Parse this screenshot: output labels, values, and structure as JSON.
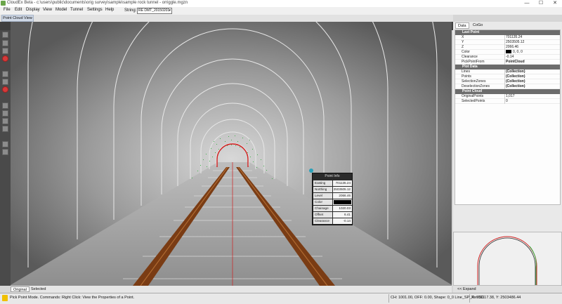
{
  "window": {
    "title": "CloudEx Beta - c:\\users\\public\\documents\\orig survey\\sample\\sample rock tunnel - orriggle.mgzn",
    "controls": {
      "minimize": "—",
      "maximize": "☐",
      "close": "✕"
    }
  },
  "menu": [
    "File",
    "Edit",
    "Display",
    "View",
    "Model",
    "Tunnel",
    "Settings",
    "Help"
  ],
  "string_selector": {
    "label": "String:",
    "value": "RE DMT_20150201"
  },
  "doc_tab": "Point Cloud View",
  "view_tabs": [
    "Original",
    "Selected"
  ],
  "point_info": {
    "title": "Point Info",
    "rows": [
      {
        "key": "Easting",
        "value": "701135.24"
      },
      {
        "key": "Northing",
        "value": "2503505.12"
      },
      {
        "key": "Level",
        "value": "2066.46"
      },
      {
        "key": "Color",
        "value": ""
      },
      {
        "key": "Chainage",
        "value": "1020.03"
      },
      {
        "key": "Offset",
        "value": "6.41"
      },
      {
        "key": "Clearance",
        "value": "-0.14"
      }
    ]
  },
  "right_panel": {
    "tabs": [
      "Data",
      "CoGo"
    ],
    "groups": [
      {
        "name": "Last Point",
        "rows": [
          {
            "key": "X",
            "value": "701135.24"
          },
          {
            "key": "Y",
            "value": "2503505.12"
          },
          {
            "key": "Z",
            "value": "2066.46"
          },
          {
            "key": "Color",
            "value": "0, 0, 0",
            "swatch": "#000000"
          },
          {
            "key": "Clearance",
            "value": "-0.14"
          },
          {
            "key": "PickPointFrom",
            "value": "PointCloud",
            "bold": true
          }
        ]
      },
      {
        "name": "Plot Data",
        "rows": [
          {
            "key": "Lines",
            "value": "(Collection)",
            "bold": true
          },
          {
            "key": "Points",
            "value": "(Collection)",
            "bold": true
          },
          {
            "key": "SelectionZones",
            "value": "(Collection)",
            "bold": true
          },
          {
            "key": "DeselectionZones",
            "value": "(Collection)",
            "bold": true
          }
        ]
      },
      {
        "name": "Point Cloud",
        "rows": [
          {
            "key": "OriginalPoints",
            "value": "1,017"
          },
          {
            "key": "SelectedPoints",
            "value": "0"
          }
        ]
      }
    ],
    "expand": "<< Expand"
  },
  "status": {
    "mode": "Pick Point Mode. Commands: Right Click: View the Properties of a Point.",
    "ch": "CH: 1001.00, OFF: 0.00, Shape: 0_0 Line_SP_Rev.50",
    "coords": "X: 701117.38, Y: 2503486.44"
  },
  "colors": {
    "rail": "#7a3c14",
    "tunnel_profile": "#e0e0e0",
    "cross_section": "#d02020",
    "points": "#3fb24a"
  }
}
